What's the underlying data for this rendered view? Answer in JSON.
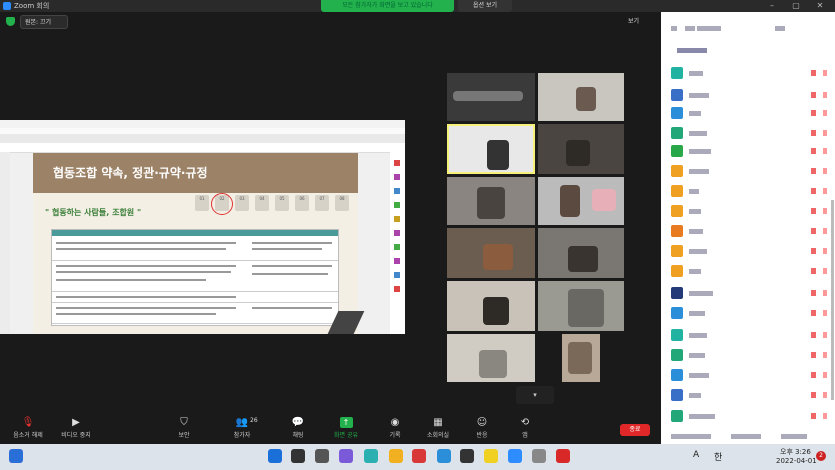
{
  "window": {
    "title": "Zoom 회의",
    "minimize": "–",
    "maximize": "▢",
    "close": "✕"
  },
  "share_banner": {
    "text": "모든 참가자가 화면을 보고 있습니다",
    "view_options": "옵션 보기"
  },
  "controls": {
    "original_size": "원본: 끄기",
    "view": "보기"
  },
  "slide": {
    "title": "협동조합 약속, 정관·규약·규정",
    "subtitle": "\" 협동하는 사람들, 조합원 \"",
    "steps": [
      "01",
      "02",
      "03",
      "04",
      "05",
      "06",
      "07",
      "08"
    ]
  },
  "grid_more": "▾",
  "toolbar": {
    "mute": "음소거 해제",
    "video": "비디오 중지",
    "security": "보안",
    "participants": "참가자",
    "participants_count": "26",
    "chat": "채팅",
    "share": "화면 공유",
    "record": "기록",
    "rooms": "소회의실",
    "reactions": "반응",
    "apps": "앱",
    "end": "종료"
  },
  "tray": {
    "lang": "A",
    "ime": "한",
    "time": "오후 3:26",
    "date": "2022-04-01",
    "notifications": "2"
  },
  "colors": {
    "share_green": "#22b14c",
    "end_red": "#e02828",
    "active_border": "#f5f17a",
    "slide_header": "#9c8267"
  }
}
